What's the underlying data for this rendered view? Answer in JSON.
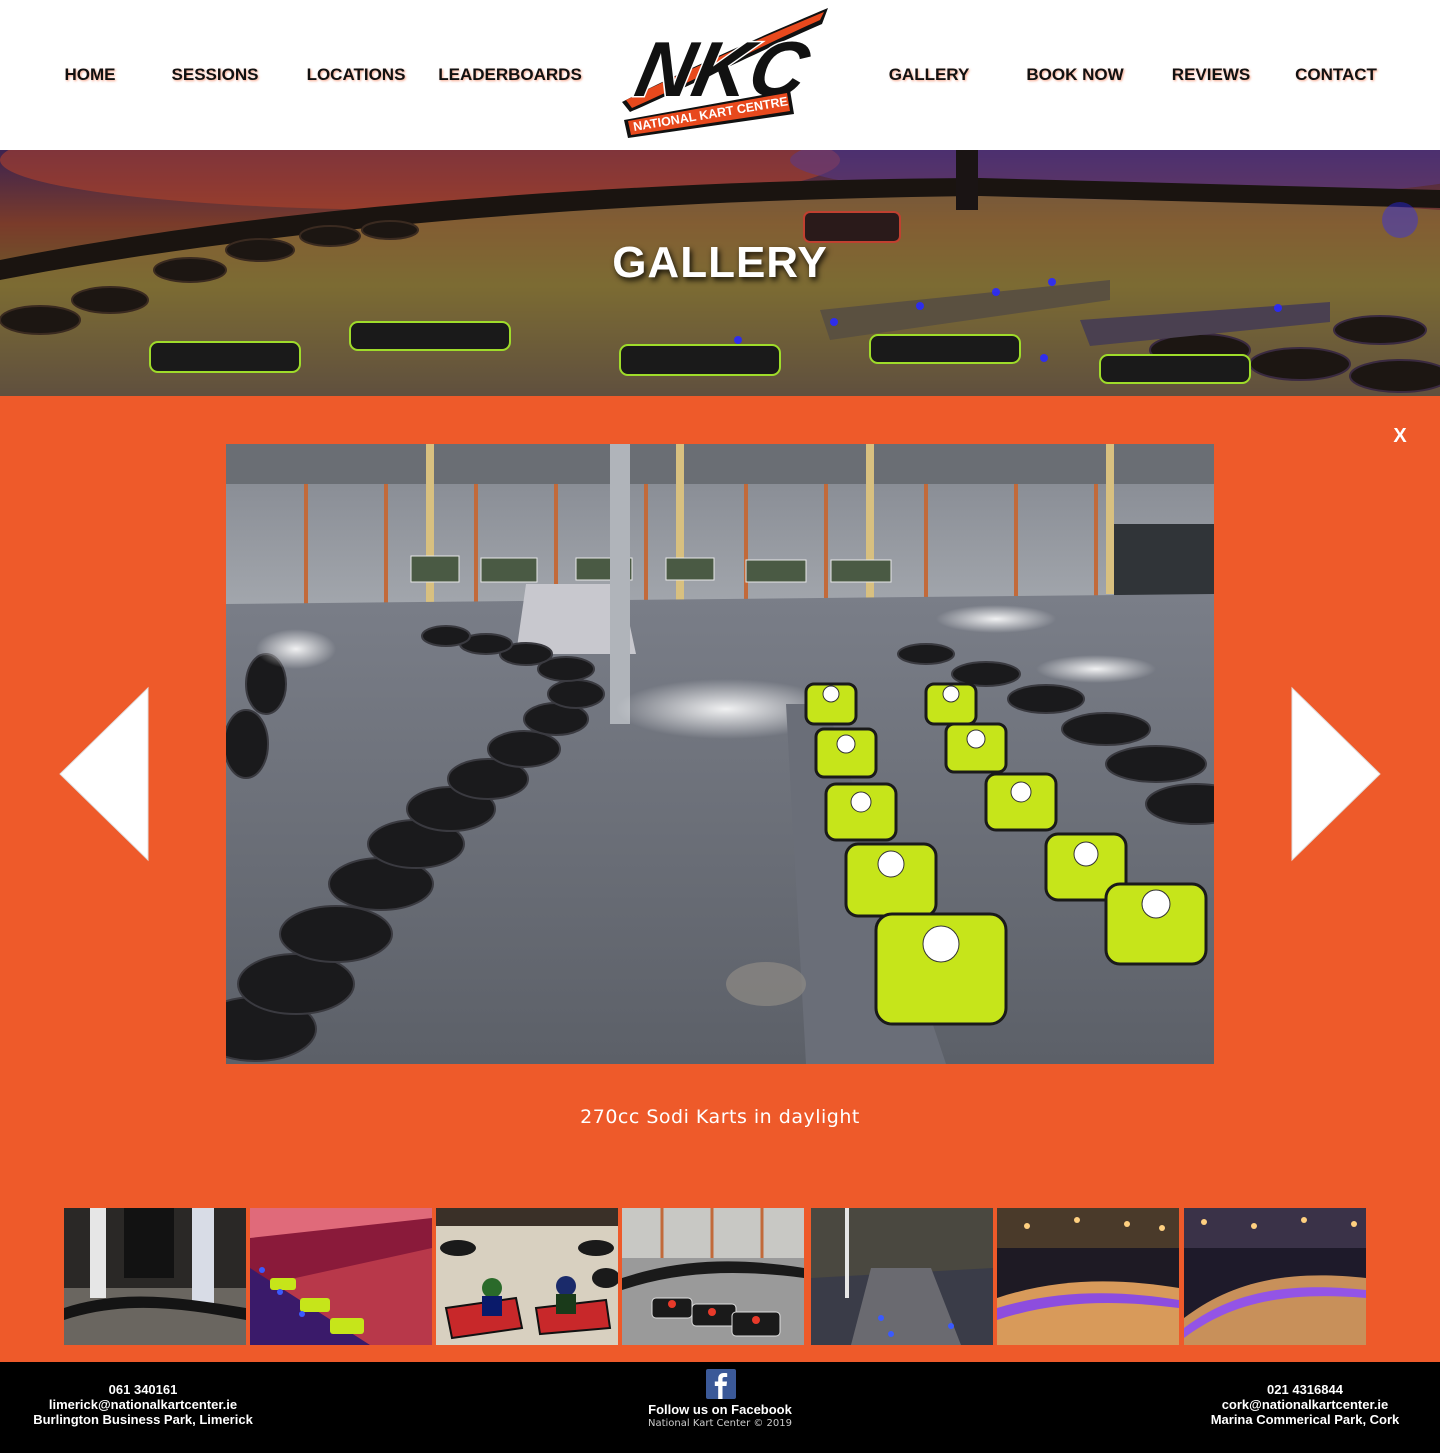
{
  "nav": {
    "left": [
      {
        "label": "HOME"
      },
      {
        "label": "SESSIONS"
      },
      {
        "label": "LOCATIONS"
      },
      {
        "label": "LEADERBOARDS"
      }
    ],
    "right": [
      {
        "label": "GALLERY"
      },
      {
        "label": "BOOK NOW"
      },
      {
        "label": "REVIEWS"
      },
      {
        "label": "CONTACT"
      }
    ]
  },
  "logo": {
    "text": "NKC",
    "tagline": "NATIONAL KART CENTRE",
    "colors": {
      "primary": "#e8491d",
      "outline": "#111111"
    }
  },
  "hero": {
    "title": "GALLERY"
  },
  "lightbox": {
    "close_label": "X",
    "caption": "270cc Sodi Karts in daylight",
    "prev_icon": "triangle-left-icon",
    "next_icon": "triangle-right-icon",
    "thumbnail_count": 7
  },
  "footer": {
    "limerick": {
      "phone": "061 340161",
      "email": "limerick@nationalkartcenter.ie",
      "address": "Burlington Business Park, Limerick"
    },
    "facebook": {
      "label": "Follow us on Facebook",
      "icon": "facebook-icon"
    },
    "copyright": "National Kart Center © 2019",
    "cork": {
      "phone": "021 4316844",
      "email": "cork@nationalkartcenter.ie",
      "address": "Marina Commerical Park, Cork"
    }
  },
  "colors": {
    "accent": "#ee5a2a",
    "footer_bg": "#000000",
    "facebook_blue": "#3b5998",
    "kart_yellow": "#c6e51a"
  }
}
